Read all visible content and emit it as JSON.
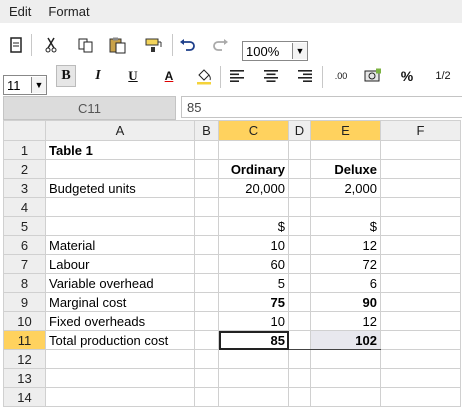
{
  "menu": [
    "Edit",
    "Format"
  ],
  "toolbar": {
    "zoom": "100%",
    "font_size": "11",
    "bold_label": "B",
    "italic_label": "I",
    "underline_label": "U",
    "font_color_label": "A",
    "decimal_label": ".00",
    "percent_label": "%",
    "fraction_label": "1/2"
  },
  "formula_bar": {
    "cell_ref": "C11",
    "formula": "85"
  },
  "sheet": {
    "columns": [
      "A",
      "B",
      "C",
      "D",
      "E",
      "F"
    ],
    "rows": [
      {
        "n": "1",
        "a": "Table 1",
        "b": "",
        "c": "",
        "d": "",
        "e": "",
        "f": ""
      },
      {
        "n": "2",
        "a": "",
        "b": "",
        "c": "Ordinary",
        "d": "",
        "e": "Deluxe",
        "f": ""
      },
      {
        "n": "3",
        "a": "Budgeted units",
        "b": "",
        "c": "20,000",
        "d": "",
        "e": "2,000",
        "f": ""
      },
      {
        "n": "4",
        "a": "",
        "b": "",
        "c": "",
        "d": "",
        "e": "",
        "f": ""
      },
      {
        "n": "5",
        "a": "",
        "b": "",
        "c": "$",
        "d": "",
        "e": "$",
        "f": ""
      },
      {
        "n": "6",
        "a": "Material",
        "b": "",
        "c": "10",
        "d": "",
        "e": "12",
        "f": ""
      },
      {
        "n": "7",
        "a": "Labour",
        "b": "",
        "c": "60",
        "d": "",
        "e": "72",
        "f": ""
      },
      {
        "n": "8",
        "a": "Variable overhead",
        "b": "",
        "c": "5",
        "d": "",
        "e": "6",
        "f": ""
      },
      {
        "n": "9",
        "a": "Marginal cost",
        "b": "",
        "c": "75",
        "d": "",
        "e": "90",
        "f": ""
      },
      {
        "n": "10",
        "a": "Fixed overheads",
        "b": "",
        "c": "10",
        "d": "",
        "e": "12",
        "f": ""
      },
      {
        "n": "11",
        "a": "Total production cost",
        "b": "",
        "c": "85",
        "d": "",
        "e": "102",
        "f": ""
      },
      {
        "n": "12",
        "a": "",
        "b": "",
        "c": "",
        "d": "",
        "e": "",
        "f": ""
      },
      {
        "n": "13",
        "a": "",
        "b": "",
        "c": "",
        "d": "",
        "e": "",
        "f": ""
      },
      {
        "n": "14",
        "a": "",
        "b": "",
        "c": "",
        "d": "",
        "e": "",
        "f": ""
      }
    ]
  },
  "colors": {
    "selection_header": "#ffd25e",
    "header_bg": "#eeeeee",
    "grid_line": "#d0d0d0"
  }
}
